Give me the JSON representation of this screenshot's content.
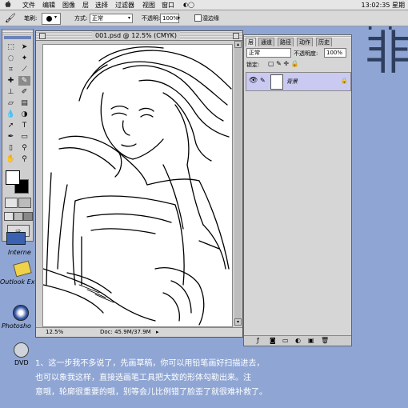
{
  "menu": {
    "items": [
      "文件",
      "编辑",
      "图像",
      "层",
      "选择",
      "过滤器",
      "视图",
      "窗口"
    ],
    "clock": "13:02:35 星期"
  },
  "background_text": "非",
  "options_bar": {
    "brush_label": "笔刷:",
    "mode_label": "方式:",
    "mode_value": "正常",
    "opacity_label": "不透明:",
    "opacity_value": "100%",
    "wet_edges_label": "湿边缘"
  },
  "document": {
    "title": "001.psd @ 12.5% (CMYK)",
    "zoom": "12.5%",
    "doc_info": "Doc: 45.9M/37.9M"
  },
  "layers_panel": {
    "tabs": [
      "层",
      "通道",
      "路径",
      "动作",
      "历史"
    ],
    "mode_value": "正常",
    "opacity_label": "不透明度:",
    "opacity_value": "100%",
    "lock_label": "锁定:",
    "layer_name": "背景"
  },
  "desktop": {
    "icons": [
      {
        "label": "Interne"
      },
      {
        "label": "Outlook Ex"
      },
      {
        "label": "Photosho"
      },
      {
        "label": "DVD"
      }
    ]
  },
  "caption": {
    "line1": "1、这一步我不多说了，先画草稿，你可以用铅笔画好扫描进去，",
    "line2": "也可以象我这样，直接选画笔工具把大致的形体勾勒出来。注",
    "line3": "意哦，轮廓很重要的哦，别等会儿比例错了脸歪了就很难补救了。"
  },
  "colors": {
    "desktop": "#8fa6d4",
    "layer_selected": "#c9c9f2"
  }
}
